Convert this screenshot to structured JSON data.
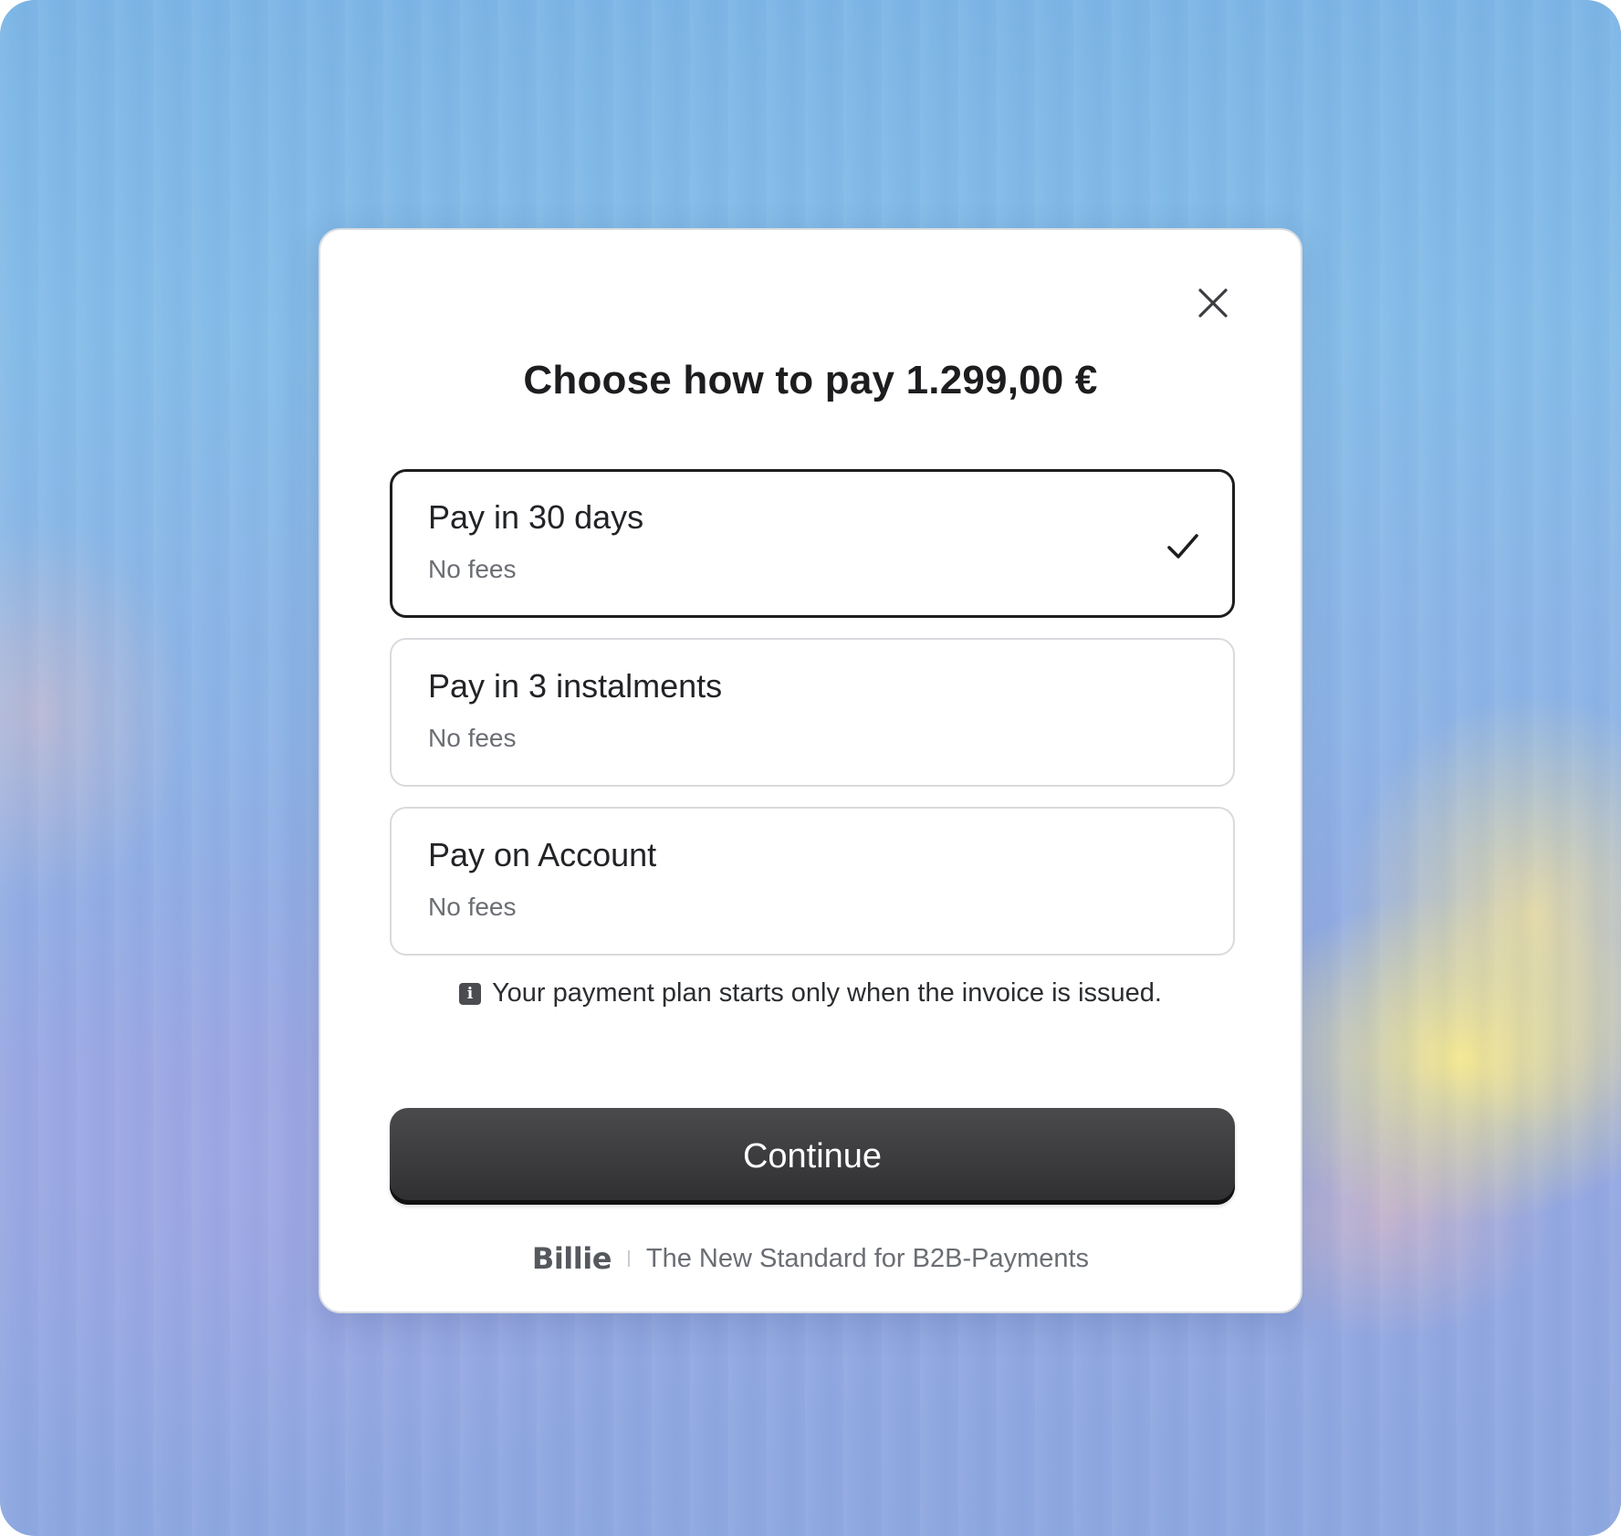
{
  "modal": {
    "close_icon": "close-icon",
    "title": "Choose how to pay 1.299,00 €",
    "options": [
      {
        "label": "Pay in 30 days",
        "subtitle": "No fees",
        "selected": true
      },
      {
        "label": "Pay in 3 instalments",
        "subtitle": "No fees",
        "selected": false
      },
      {
        "label": "Pay on Account",
        "subtitle": "No fees",
        "selected": false
      }
    ],
    "selected_icon": "checkmark-icon",
    "info": {
      "icon": "info-icon",
      "icon_glyph": "i",
      "text": "Your payment plan starts only when the invoice is issued."
    },
    "continue_label": "Continue",
    "footer": {
      "brand": "Billie",
      "tagline": "The New Standard for B2B-Payments"
    }
  },
  "colors": {
    "button_bg": "#3a3a3c",
    "selected_border": "#1d1d1f",
    "option_border": "#d8dadd",
    "muted_text": "#6b6e73"
  }
}
